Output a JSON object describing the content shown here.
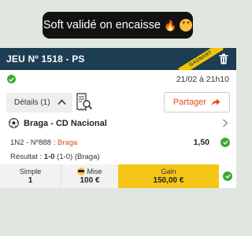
{
  "caption": {
    "text": "Soft validé on encaisse",
    "emojis": [
      "fire-emoji",
      "heart-eyes-emoji"
    ]
  },
  "ticket": {
    "title": "JEU Nº 1518 - PS",
    "status": "GAGNANT",
    "datetime": "21/02 à 21h10",
    "details_label": "Détails (1)",
    "share_label": "Partager"
  },
  "match": {
    "title": "Braga - CD Nacional",
    "market": "1N2 - Nº888 :",
    "pick": "Braga",
    "odds": "1,50",
    "result_label": "Résultat :",
    "result_score": "1-0",
    "result_detail": "(1-0) (Braga)"
  },
  "summary": {
    "type_label": "Simple",
    "type_value": "1",
    "stake_label": "Mise",
    "stake_value": "100 €",
    "gain_label": "Gain",
    "gain_value": "150,00 €"
  },
  "colors": {
    "header": "#1d3d52",
    "accent": "#e24a1c",
    "gain": "#f5c518",
    "success": "#3da934"
  }
}
